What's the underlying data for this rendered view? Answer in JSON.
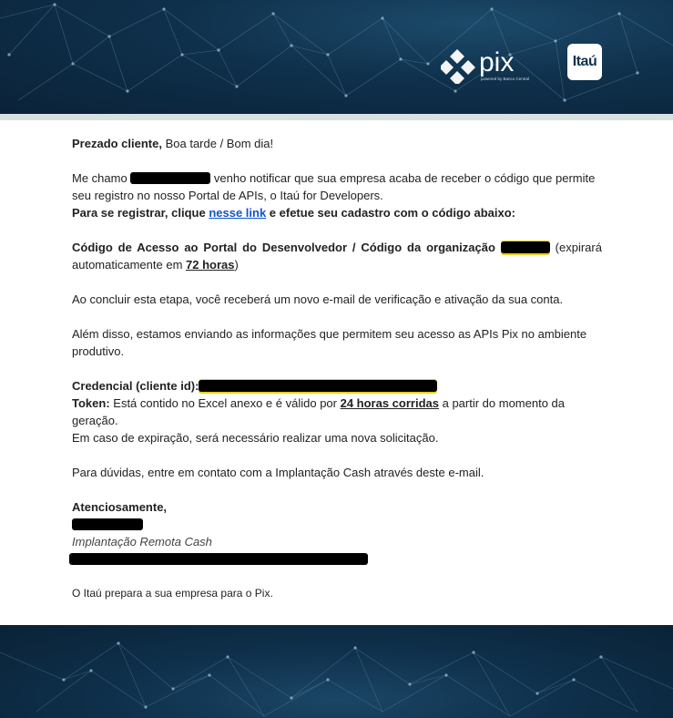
{
  "header": {
    "pix_logo_text": "pix",
    "pix_tagline": "powered by Banco Central",
    "itau_logo_text": "Itaú"
  },
  "email": {
    "greeting_bold": "Prezado cliente,",
    "greeting_rest": " Boa tarde / Bom dia!",
    "intro_prefix": "Me chamo ",
    "intro_suffix": " venho notificar que sua empresa acaba de receber o código que permite seu registro no nosso Portal de APIs, o Itaú for Developers.",
    "register_prefix": "Para se registrar, clique ",
    "register_link": "nesse link",
    "register_suffix": " e efetue seu cadastro com o código abaixo:",
    "access_code_label": "Código de Acesso ao Portal do Desenvolvedor / Código da organização",
    "access_expiry_prefix": " (expirará automaticamente em ",
    "access_expiry_hours": "72 horas",
    "access_expiry_suffix": ")",
    "verify_text": "Ao concluir esta etapa, você receberá um novo e-mail de verificação e ativação da sua conta.",
    "besides_text": "Além disso, estamos enviando as informações que permitem seu acesso as APIs Pix no ambiente produtivo.",
    "credential_label": "Credencial (cliente id):",
    "token_label": "Token:",
    "token_prefix": "  Está contido no Excel anexo e é válido por ",
    "token_hours": "24 horas corridas",
    "token_suffix": " a partir do momento da geração.",
    "expiration_text": "Em caso de expiração, será necessário realizar uma nova solicitação.",
    "doubts_text": "Para dúvidas, entre em contato com a Implantação Cash através deste e-mail.",
    "regards": "Atenciosamente,",
    "signature_title": "Implantação Remota Cash",
    "closing": "O Itaú prepara a sua empresa para o Pix."
  },
  "colors": {
    "header_bg": "#0f304b",
    "link": "#1155cc",
    "redaction": "#000000",
    "highlight": "#e7d21a"
  }
}
